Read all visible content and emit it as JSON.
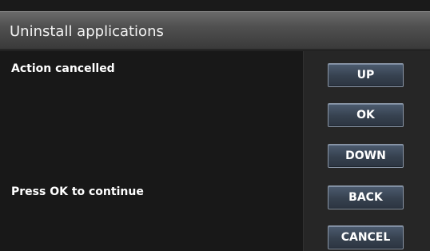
{
  "header": {
    "title": "Uninstall applications"
  },
  "messages": {
    "status": "Action cancelled",
    "hint": "Press OK to continue"
  },
  "buttons": {
    "up": "UP",
    "ok": "OK",
    "down": "DOWN",
    "back": "BACK",
    "cancel": "CANCEL"
  },
  "colors": {
    "title_bar": "#505050",
    "panel_background": "#181818",
    "button_fill": "#3a4656",
    "button_border": "#8a96a6",
    "text": "#ffffff"
  }
}
